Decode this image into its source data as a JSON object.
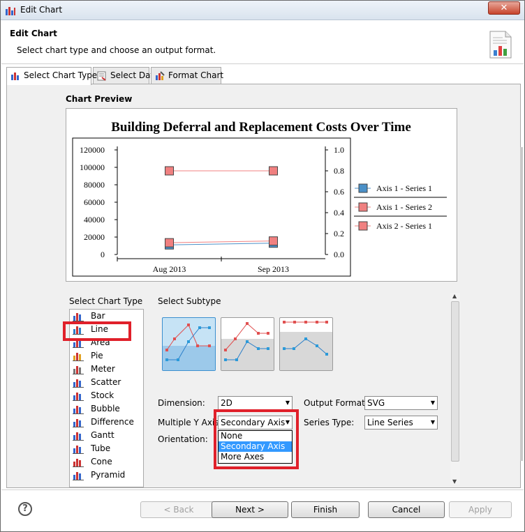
{
  "window": {
    "title": "Edit Chart"
  },
  "header": {
    "title": "Edit Chart",
    "description": "Select chart type and choose an output format."
  },
  "tabs": [
    "Select Chart Type",
    "Select Data",
    "Format Chart"
  ],
  "preview": {
    "label": "Chart Preview"
  },
  "chart_data": {
    "type": "line",
    "title": "Building Deferral and Replacement Costs Over Time",
    "categories": [
      "Aug 2013",
      "Sep 2013"
    ],
    "y_left_ticks": [
      "120000",
      "100000",
      "80000",
      "60000",
      "40000",
      "20000",
      "0"
    ],
    "y_right_ticks": [
      "1.0",
      "0.8",
      "0.6",
      "0.4",
      "0.2",
      "0.0"
    ],
    "ylim_left": [
      0,
      120000
    ],
    "ylim_right": [
      0,
      1.0
    ],
    "series": [
      {
        "name": "Axis 1 - Series 1",
        "axis": "left",
        "values": [
          11000,
          13000
        ],
        "color": "#4a90c8"
      },
      {
        "name": "Axis 1 - Series 2",
        "axis": "left",
        "values": [
          13500,
          15500
        ],
        "color": "#f08080"
      },
      {
        "name": "Axis 2 - Series 1",
        "axis": "right",
        "values": [
          0.8,
          0.8
        ],
        "color": "#f08080"
      }
    ],
    "legend": "right"
  },
  "chart_type": {
    "label": "Select Chart Type",
    "items": [
      "Bar",
      "Line",
      "Area",
      "Pie",
      "Meter",
      "Scatter",
      "Stock",
      "Bubble",
      "Difference",
      "Gantt",
      "Tube",
      "Cone",
      "Pyramid"
    ],
    "selected": "Line"
  },
  "subtype": {
    "label": "Select Subtype"
  },
  "options": {
    "dimension_label": "Dimension:",
    "dimension_value": "2D",
    "multiple_y_label": "Multiple Y Axis:",
    "multiple_y_value": "Secondary Axis",
    "orientation_label": "Orientation:",
    "output_label": "Output Format:",
    "output_value": "SVG",
    "series_type_label": "Series Type:",
    "series_type_value": "Line Series",
    "multiple_y_options": [
      "None",
      "Secondary Axis",
      "More Axes"
    ]
  },
  "footer": {
    "help": "?",
    "back": "< Back",
    "next": "Next >",
    "finish": "Finish",
    "cancel": "Cancel",
    "apply": "Apply"
  },
  "colors": {
    "highlight": "#e0202a",
    "selection": "#3399ff"
  }
}
